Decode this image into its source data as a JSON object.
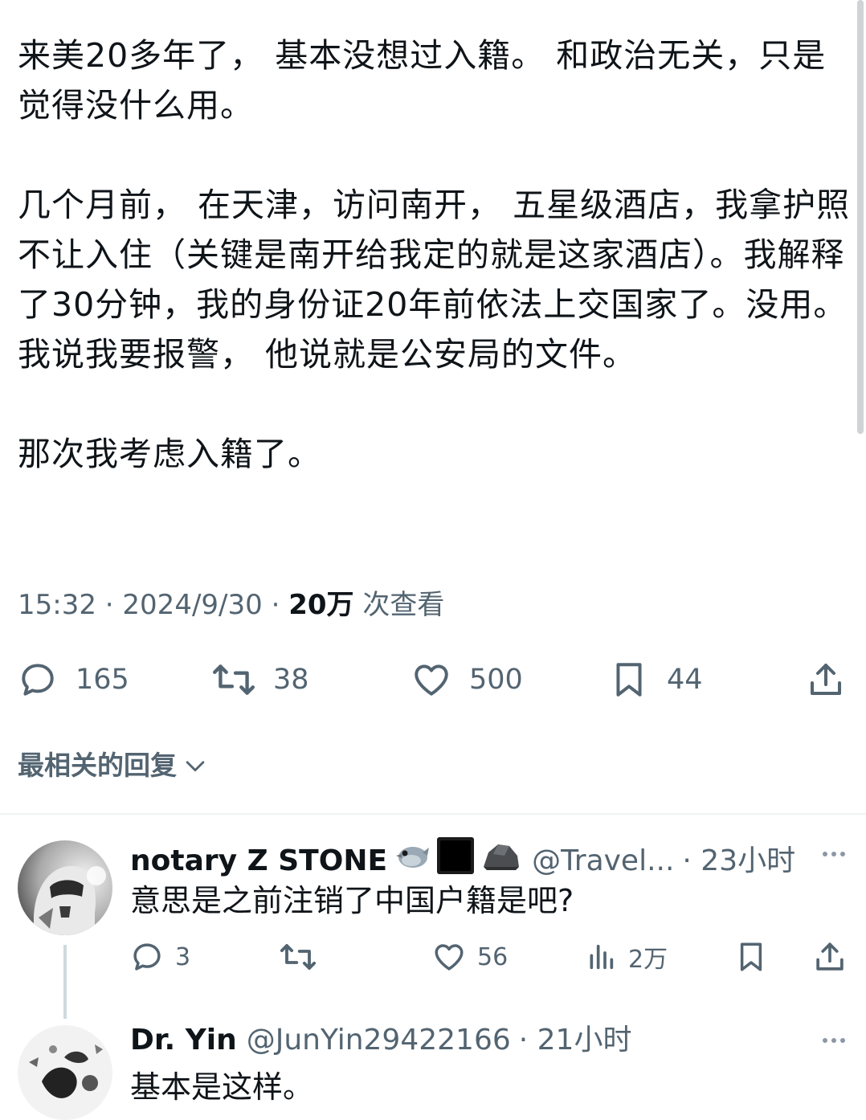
{
  "tweet": {
    "paragraphs": [
      "来美20多年了， 基本没想过入籍。 和政治无关，只是觉得没什么用。",
      "几个月前， 在天津，访问南开， 五星级酒店，我拿护照不让入住（关键是南开给我定的就是这家酒店）。我解释了30分钟，我的身份证20年前依法上交国家了。没用。 我说我要报警， 他说就是公安局的文件。",
      "那次我考虑入籍了。"
    ],
    "time": "15:32",
    "date": "2024/9/30",
    "views_count": "20万",
    "views_label": "次查看",
    "sep": "·",
    "actions": {
      "reply": "165",
      "retweet": "38",
      "like": "500",
      "bookmark": "44"
    }
  },
  "replies_header": {
    "label": "最相关的回复"
  },
  "replies": [
    {
      "name": "notary Z STONE",
      "handle": "@Travel...",
      "time": "· 23小时",
      "text": "意思是之前注销了中国户籍是吧?",
      "actions": {
        "reply": "3",
        "like": "56",
        "views": "2万"
      }
    },
    {
      "name": "Dr. Yin",
      "handle": "@JunYin29422166",
      "time": "· 21小时",
      "text": "基本是这样。"
    }
  ],
  "colors": {
    "text": "#0f1419",
    "secondary": "#536471",
    "divider": "#eff3f4"
  }
}
